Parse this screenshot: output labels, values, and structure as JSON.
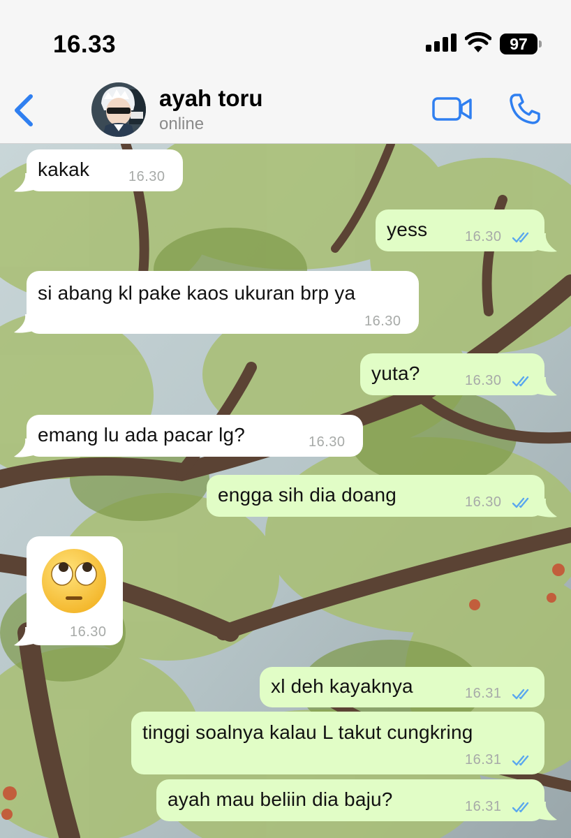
{
  "status_bar": {
    "time": "16.33",
    "battery": "97"
  },
  "header": {
    "contact_name": "ayah toru",
    "contact_status": "online",
    "icons": [
      "back-chevron-icon",
      "video-call-icon",
      "phone-call-icon"
    ]
  },
  "colors": {
    "accent": "#2f7ff0",
    "incoming_bubble": "#ffffff",
    "outgoing_bubble": "#e1fdc6",
    "read_ticks": "#5aa7ee"
  },
  "messages": [
    {
      "direction": "in",
      "text": "kakak",
      "time": "16.30"
    },
    {
      "direction": "out",
      "text": "yess",
      "time": "16.30",
      "status": "read"
    },
    {
      "direction": "in",
      "text": "si abang kl pake kaos ukuran brp ya",
      "time": "16.30"
    },
    {
      "direction": "out",
      "text": "yuta?",
      "time": "16.30",
      "status": "read"
    },
    {
      "direction": "in",
      "text": "emang lu ada pacar lg?",
      "time": "16.30"
    },
    {
      "direction": "out",
      "text": "engga sih dia doang",
      "time": "16.30",
      "status": "read"
    },
    {
      "direction": "in",
      "emoji": "face-with-rolling-eyes",
      "time": "16.30"
    },
    {
      "direction": "out",
      "text": "xl deh kayaknya",
      "time": "16.31",
      "status": "read"
    },
    {
      "direction": "out",
      "text": "tinggi soalnya kalau L takut cungkring",
      "time": "16.31",
      "status": "read"
    },
    {
      "direction": "out",
      "text": "ayah mau beliin dia baju?",
      "time": "16.31",
      "status": "read"
    }
  ]
}
